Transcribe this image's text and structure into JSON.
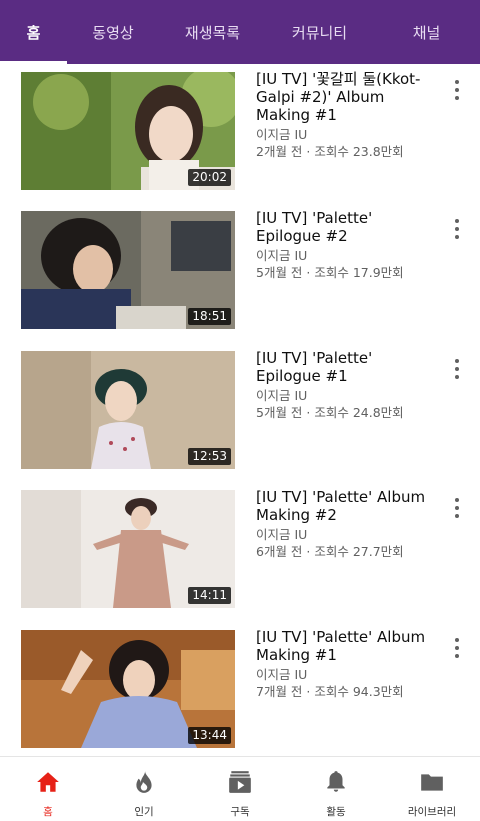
{
  "tabs": [
    {
      "label": "홈",
      "active": true
    },
    {
      "label": "동영상",
      "active": false
    },
    {
      "label": "재생목록",
      "active": false
    },
    {
      "label": "커뮤니티",
      "active": false
    },
    {
      "label": "채널",
      "active": false
    }
  ],
  "videos": [
    {
      "title": "[IU TV] '꽃갈피 둘(Kkot-Galpi #2)' Album Making #1",
      "channel": "이지금 IU",
      "stats": "2개월 전 · 조회수 23.8만회",
      "duration": "20:02"
    },
    {
      "title": "[IU TV] 'Palette' Epilogue #2",
      "channel": "이지금 IU",
      "stats": "5개월 전 · 조회수 17.9만회",
      "duration": "18:51"
    },
    {
      "title": "[IU TV] 'Palette' Epilogue #1",
      "channel": "이지금 IU",
      "stats": "5개월 전 · 조회수 24.8만회",
      "duration": "12:53"
    },
    {
      "title": "[IU TV] 'Palette' Album Making #2",
      "channel": "이지금 IU",
      "stats": "6개월 전 · 조회수 27.7만회",
      "duration": "14:11"
    },
    {
      "title": "[IU TV] 'Palette' Album Making #1",
      "channel": "이지금 IU",
      "stats": "7개월 전 · 조회수 94.3만회",
      "duration": "13:44"
    }
  ],
  "bottom_nav": [
    {
      "label": "홈",
      "icon": "home-icon",
      "active": true
    },
    {
      "label": "인기",
      "icon": "trending-icon",
      "active": false
    },
    {
      "label": "구독",
      "icon": "subscriptions-icon",
      "active": false
    },
    {
      "label": "활동",
      "icon": "bell-icon",
      "active": false
    },
    {
      "label": "라이브러리",
      "icon": "folder-icon",
      "active": false
    }
  ],
  "colors": {
    "header_bg": "#5a2c83",
    "active_nav": "#e62117"
  }
}
